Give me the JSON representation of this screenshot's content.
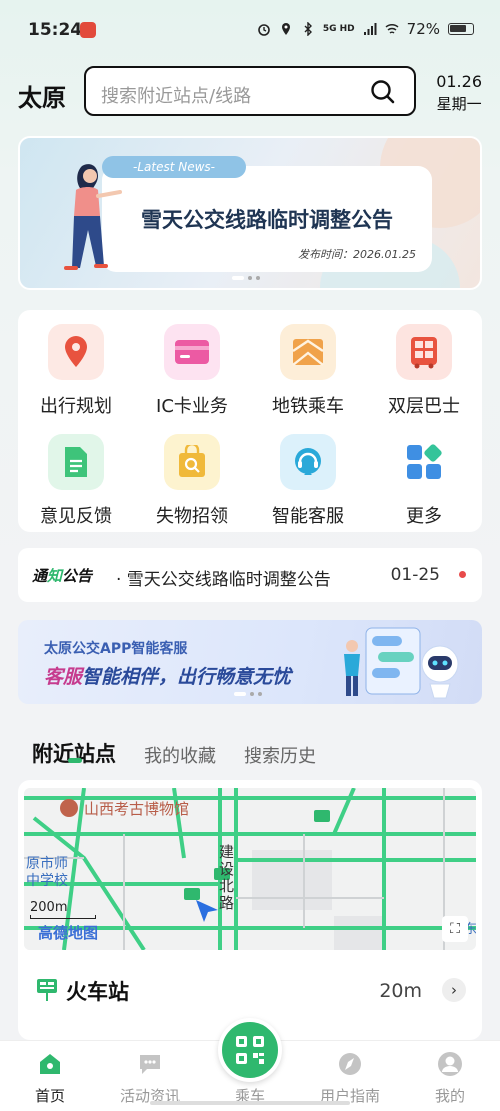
{
  "status_bar": {
    "time": "15:24",
    "network": "5G HD",
    "battery": "72%"
  },
  "header": {
    "city": "太原",
    "search_placeholder": "搜索附近站点/线路",
    "date": "01.26",
    "weekday": "星期一"
  },
  "banner": {
    "tag": "-Latest News-",
    "title": "雪天公交线路临时调整公告",
    "date": "发布时间：2026.01.25"
  },
  "services": [
    {
      "label": "出行规划",
      "icon": "map-pin-icon",
      "color": "#e8533f"
    },
    {
      "label": "IC卡业务",
      "icon": "card-icon",
      "color": "#ec5aa3"
    },
    {
      "label": "地铁乘车",
      "icon": "metro-icon",
      "color": "#f0a24a"
    },
    {
      "label": "双层巴士",
      "icon": "double-decker-bus-icon",
      "color": "#e8533f"
    },
    {
      "label": "意见反馈",
      "icon": "feedback-doc-icon",
      "color": "#3ec47a"
    },
    {
      "label": "失物招领",
      "icon": "lost-found-bag-icon",
      "color": "#f0b93a"
    },
    {
      "label": "智能客服",
      "icon": "headset-chat-icon",
      "color": "#2aa9d9"
    },
    {
      "label": "更多",
      "icon": "more-grid-icon",
      "color": "#3f8fe3"
    }
  ],
  "notice": {
    "tag_a": "通",
    "tag_b": "知",
    "tag_c": "公告",
    "text": "·  雪天公交线路临时调整公告",
    "date": "01-25"
  },
  "promo": {
    "line1": "太原公交APP智能客服",
    "line2_highlight": "客服",
    "line2_rest": "智能相伴，出行畅意无忧"
  },
  "tabs": [
    "附近站点",
    "我的收藏",
    "搜索历史"
  ],
  "map": {
    "poi": "山西考古博物馆",
    "school": "原市师\n中学校",
    "road": "建\n设\n北\n路",
    "scale": "200m",
    "logo": "高德地图",
    "edge_label": "东"
  },
  "station": {
    "name": "火车站",
    "distance": "20m"
  },
  "bottom_nav": [
    {
      "label": "首页",
      "icon": "home-icon"
    },
    {
      "label": "活动资讯",
      "icon": "chat-bubble-icon"
    },
    {
      "label": "乘车",
      "icon": "qr-code-icon"
    },
    {
      "label": "用户指南",
      "icon": "compass-icon"
    },
    {
      "label": "我的",
      "icon": "profile-icon"
    }
  ],
  "accent_color": "#2fb86e"
}
